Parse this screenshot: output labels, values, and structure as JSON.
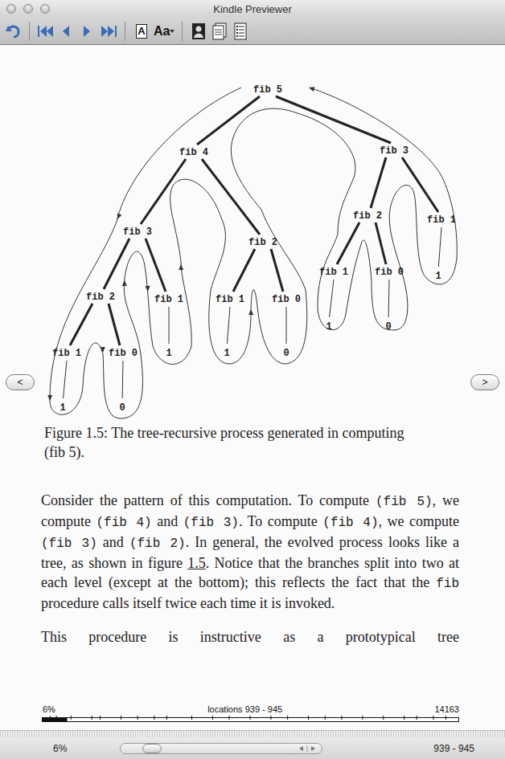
{
  "window": {
    "title": "Kindle Previewer"
  },
  "toolbar": {
    "font_button": "A",
    "font_size_button": "Aa"
  },
  "nav_buttons": {
    "previous": "<",
    "next": ">"
  },
  "figure": {
    "tree": {
      "label": "fib 5",
      "kind": "call",
      "children": [
        {
          "label": "fib 4",
          "kind": "call",
          "children": [
            {
              "label": "fib 3",
              "kind": "call",
              "children": [
                {
                  "label": "fib 2",
                  "kind": "call",
                  "children": [
                    {
                      "label": "fib 1",
                      "kind": "call",
                      "children": [
                        {
                          "label": "1",
                          "kind": "value"
                        }
                      ]
                    },
                    {
                      "label": "fib 0",
                      "kind": "call",
                      "children": [
                        {
                          "label": "0",
                          "kind": "value"
                        }
                      ]
                    }
                  ]
                },
                {
                  "label": "fib 1",
                  "kind": "call",
                  "children": [
                    {
                      "label": "1",
                      "kind": "value"
                    }
                  ]
                }
              ]
            },
            {
              "label": "fib 2",
              "kind": "call",
              "children": [
                {
                  "label": "fib 1",
                  "kind": "call",
                  "children": [
                    {
                      "label": "1",
                      "kind": "value"
                    }
                  ]
                },
                {
                  "label": "fib 0",
                  "kind": "call",
                  "children": [
                    {
                      "label": "0",
                      "kind": "value"
                    }
                  ]
                }
              ]
            }
          ]
        },
        {
          "label": "fib 3",
          "kind": "call",
          "children": [
            {
              "label": "fib 2",
              "kind": "call",
              "children": [
                {
                  "label": "fib 1",
                  "kind": "call",
                  "children": [
                    {
                      "label": "1",
                      "kind": "value"
                    }
                  ]
                },
                {
                  "label": "fib 0",
                  "kind": "call",
                  "children": [
                    {
                      "label": "0",
                      "kind": "value"
                    }
                  ]
                }
              ]
            },
            {
              "label": "fib 1",
              "kind": "call",
              "children": [
                {
                  "label": "1",
                  "kind": "value"
                }
              ]
            }
          ]
        }
      ]
    },
    "caption": "Figure 1.5:  The tree-recursive process generated in computing (fib 5)."
  },
  "paragraphs": [
    {
      "truncated": false,
      "segments": [
        {
          "text": "Consider the pattern of this computation. To compute ",
          "kind": "text"
        },
        {
          "text": "(fib 5)",
          "kind": "code"
        },
        {
          "text": ", we compute ",
          "kind": "text"
        },
        {
          "text": "(fib 4)",
          "kind": "code"
        },
        {
          "text": " and ",
          "kind": "text"
        },
        {
          "text": "(fib 3)",
          "kind": "code"
        },
        {
          "text": ". To compute ",
          "kind": "text"
        },
        {
          "text": "(fib 4)",
          "kind": "code"
        },
        {
          "text": ", we compute ",
          "kind": "text"
        },
        {
          "text": "(fib 3)",
          "kind": "code"
        },
        {
          "text": " and ",
          "kind": "text"
        },
        {
          "text": "(fib 2)",
          "kind": "code"
        },
        {
          "text": ". In general, the evolved process looks like a tree, as shown in figure ",
          "kind": "text"
        },
        {
          "text": "1.5",
          "kind": "link"
        },
        {
          "text": ". Notice that the branches split into two at each level (except at the bottom); this reflects the fact that the ",
          "kind": "text"
        },
        {
          "text": "fib",
          "kind": "code"
        },
        {
          "text": " procedure calls itself twice each time it is invoked.",
          "kind": "text"
        }
      ]
    },
    {
      "truncated": true,
      "segments": [
        {
          "text": "This procedure is instructive as a prototypical tree",
          "kind": "text"
        }
      ]
    }
  ],
  "progress": {
    "percent": "6%",
    "locations": "locations 939 - 945",
    "total": "14163",
    "level": 0.06
  },
  "status_bar": {
    "percent": "6%",
    "level": 0.06,
    "range": "939 - 945"
  }
}
